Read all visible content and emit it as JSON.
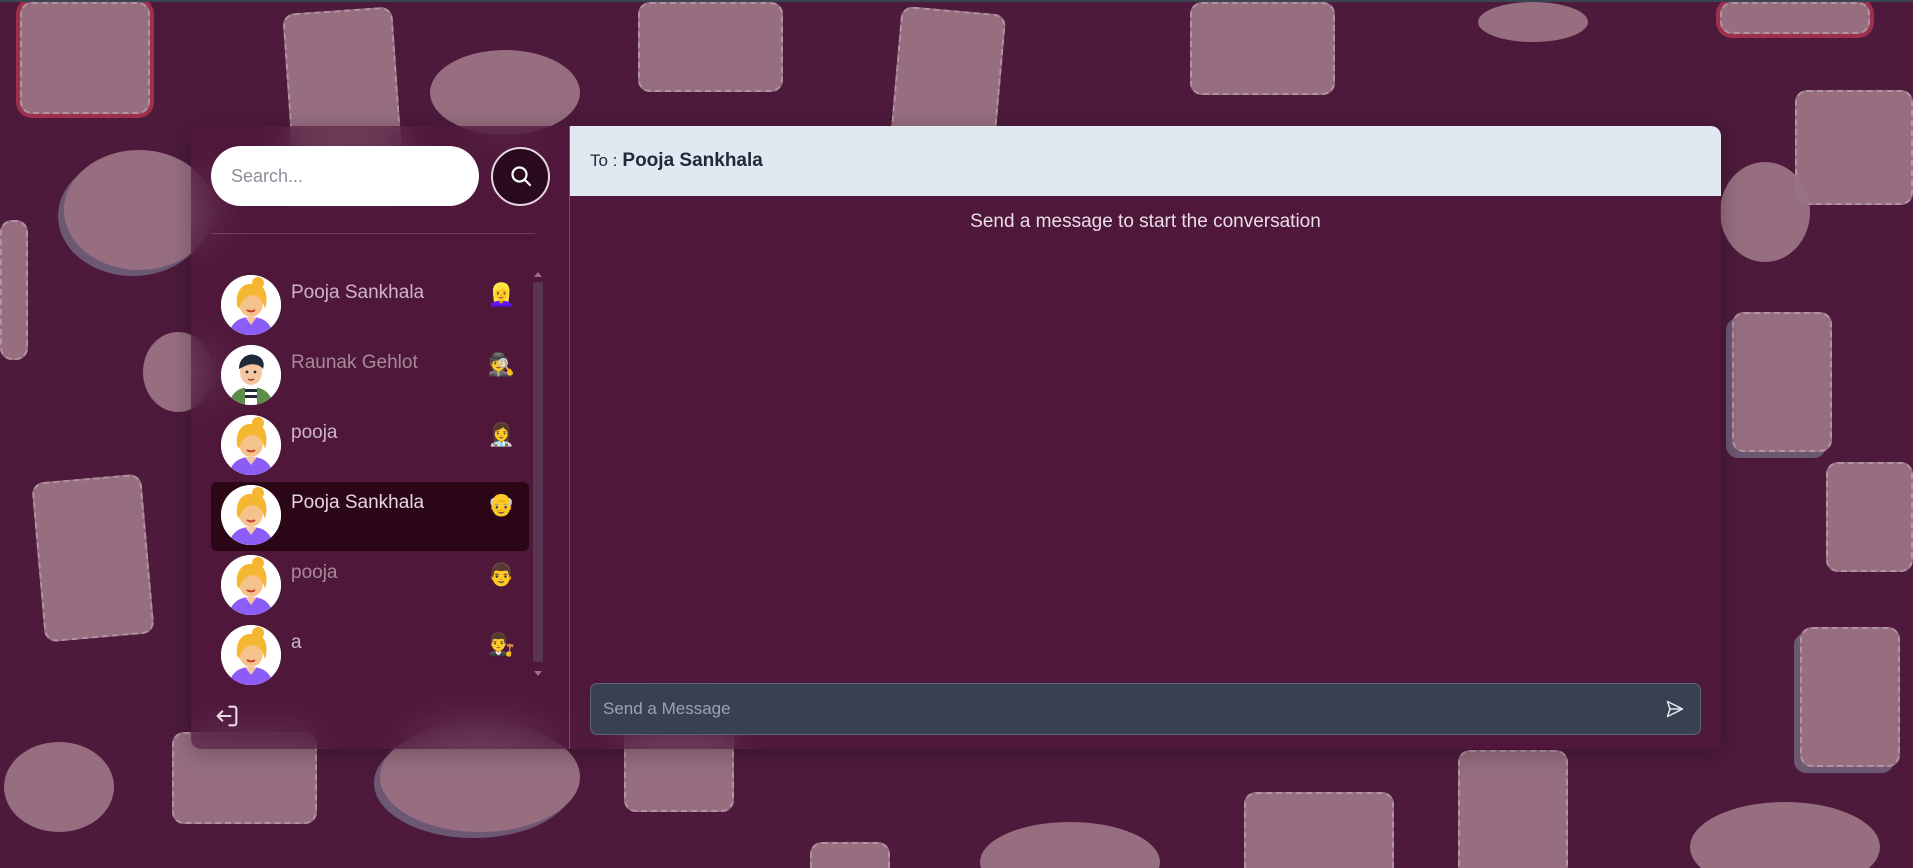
{
  "search": {
    "placeholder": "Search..."
  },
  "contacts": [
    {
      "name": "Pooja Sankhala",
      "emoji": "👱‍♀️",
      "avatar": "female",
      "active": false,
      "dim": false
    },
    {
      "name": "Raunak Gehlot",
      "emoji": "🕵️",
      "avatar": "male",
      "active": false,
      "dim": true
    },
    {
      "name": "pooja",
      "emoji": "👩‍⚕️",
      "avatar": "female",
      "active": false,
      "dim": false
    },
    {
      "name": "Pooja Sankhala",
      "emoji": "👴",
      "avatar": "female",
      "active": true,
      "dim": false
    },
    {
      "name": "pooja",
      "emoji": "👨",
      "avatar": "female",
      "active": false,
      "dim": true
    },
    {
      "name": "a",
      "emoji": "👨‍⚖️",
      "avatar": "female",
      "active": false,
      "dim": false
    }
  ],
  "chat": {
    "to_label": "To :",
    "recipient": "Pooja Sankhala",
    "empty_message": "Send a message to start the conversation",
    "input_placeholder": "Send a Message"
  },
  "colors": {
    "background": "#4d1a3c",
    "active_contact": "#2a0616",
    "header_bg": "#e2e8f0",
    "composer_bg": "#374151"
  },
  "icons": {
    "search_button": "search-icon",
    "logout": "logout-icon",
    "send": "send-icon"
  }
}
